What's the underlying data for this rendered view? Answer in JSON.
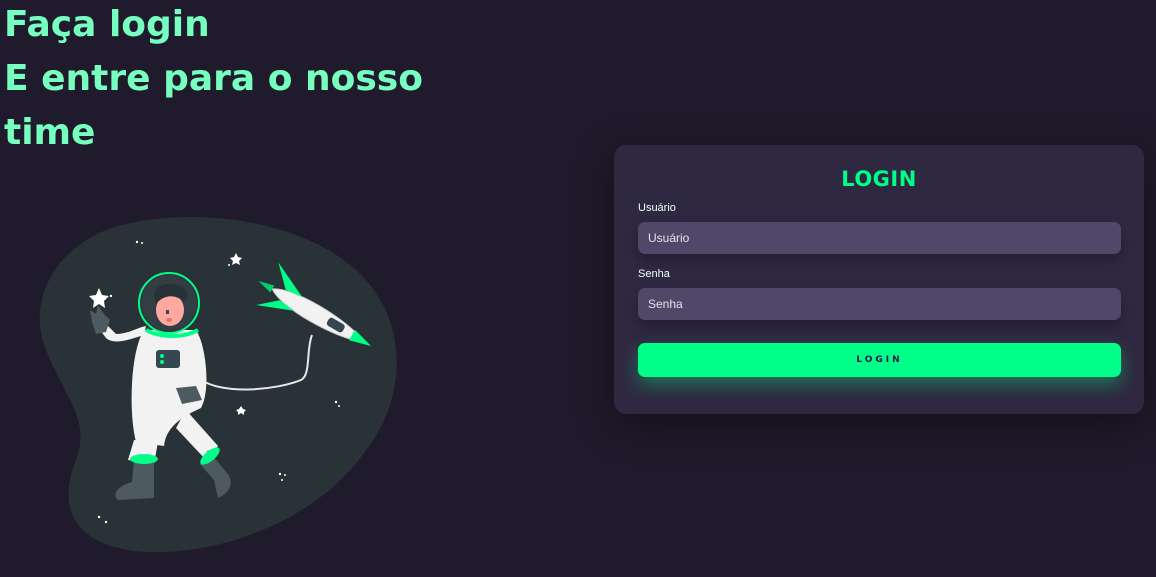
{
  "headline": {
    "line1": "Faça login",
    "line2": "E entre para o nosso",
    "line3": "time"
  },
  "illustration": {
    "icon": "astronaut-rocket-illustration"
  },
  "login_card": {
    "title": "LOGIN",
    "username": {
      "label": "Usuário",
      "placeholder": "Usuário",
      "value": ""
    },
    "password": {
      "label": "Senha",
      "placeholder": "Senha",
      "value": ""
    },
    "submit_label": "LOGIN"
  },
  "colors": {
    "background": "#201b2c",
    "card": "#2f2841",
    "input": "#514869",
    "accent": "#00ff88",
    "headline": "#77ffc0"
  }
}
